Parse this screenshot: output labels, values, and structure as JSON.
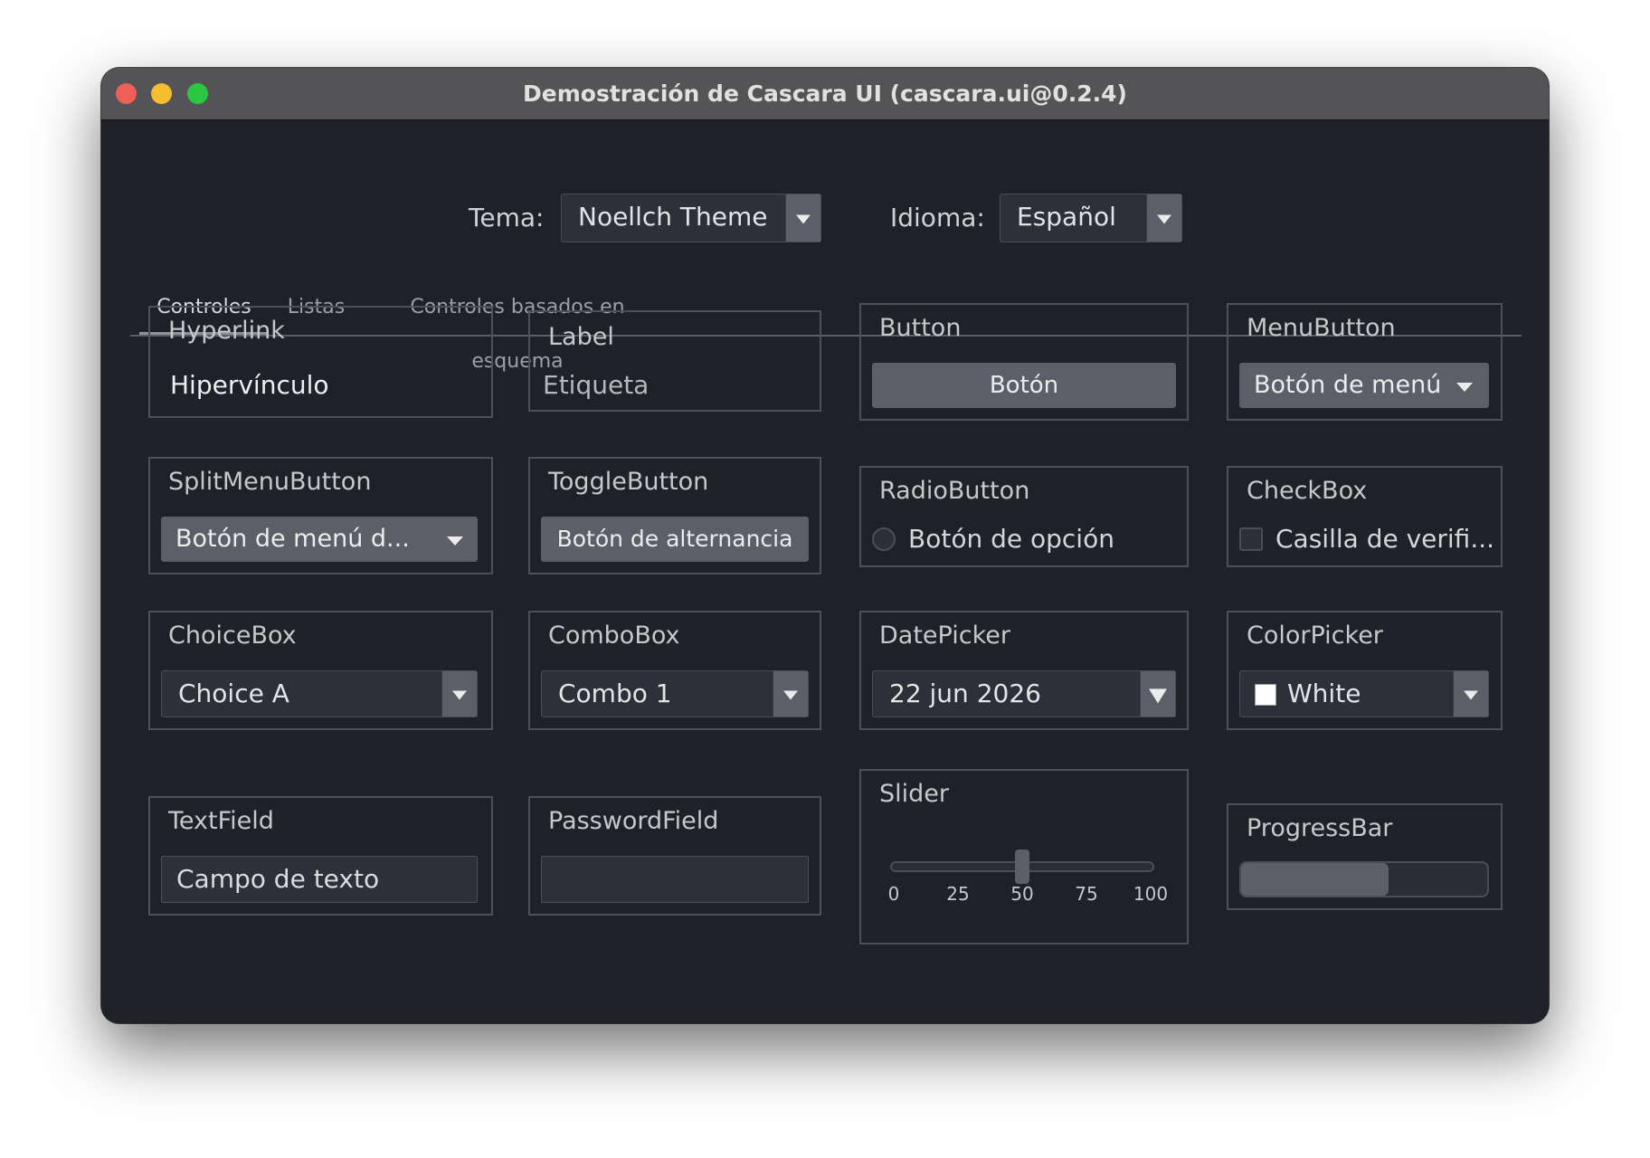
{
  "window": {
    "title": "Demostración de Cascara UI (cascara.ui@0.2.4)"
  },
  "topbar": {
    "theme_label": "Tema:",
    "theme_value": "Noellch Theme",
    "language_label": "Idioma:",
    "language_value": "Español"
  },
  "tabs": [
    {
      "label": "Controles",
      "active": true
    },
    {
      "label": "Listas",
      "active": false
    },
    {
      "label": "Controles basados en esquema",
      "active": false
    }
  ],
  "controls": {
    "hyperlink": {
      "title": "Hyperlink",
      "text": "Hipervínculo"
    },
    "label": {
      "title": "Label",
      "text": "Etiqueta"
    },
    "button": {
      "title": "Button",
      "text": "Botón"
    },
    "menubutton": {
      "title": "MenuButton",
      "text": "Botón de menú"
    },
    "splitmenubutton": {
      "title": "SplitMenuButton",
      "text": "Botón de menú d..."
    },
    "togglebutton": {
      "title": "ToggleButton",
      "text": "Botón de alternancia"
    },
    "radiobutton": {
      "title": "RadioButton",
      "text": "Botón de opción",
      "selected": false
    },
    "checkbox": {
      "title": "CheckBox",
      "text": "Casilla de verifi...",
      "checked": false
    },
    "choicebox": {
      "title": "ChoiceBox",
      "value": "Choice A"
    },
    "combobox": {
      "title": "ComboBox",
      "value": "Combo 1"
    },
    "datepicker": {
      "title": "DatePicker",
      "value": "22 jun 2026"
    },
    "colorpicker": {
      "title": "ColorPicker",
      "value": "White",
      "swatch_color": "#ffffff"
    },
    "textfield": {
      "title": "TextField",
      "value": "Campo de texto"
    },
    "passwordfield": {
      "title": "PasswordField",
      "value": ""
    },
    "slider": {
      "title": "Slider",
      "min": 0,
      "max": 100,
      "value": 50,
      "ticks": [
        "0",
        "25",
        "50",
        "75",
        "100"
      ]
    },
    "progressbar": {
      "title": "ProgressBar",
      "progress": 0.6
    }
  },
  "colors": {
    "window_bg": "#1f2128",
    "titlebar_bg": "#545456",
    "accent_gray": "#5c5f67",
    "card_border": "#4d5059",
    "traffic_red": "#ee5f57",
    "traffic_yellow": "#f5bd2f",
    "traffic_green": "#29c840"
  },
  "icons": {
    "dropdown": "chevron-down-icon",
    "window_controls": [
      "close-icon",
      "minimize-icon",
      "zoom-icon"
    ]
  }
}
